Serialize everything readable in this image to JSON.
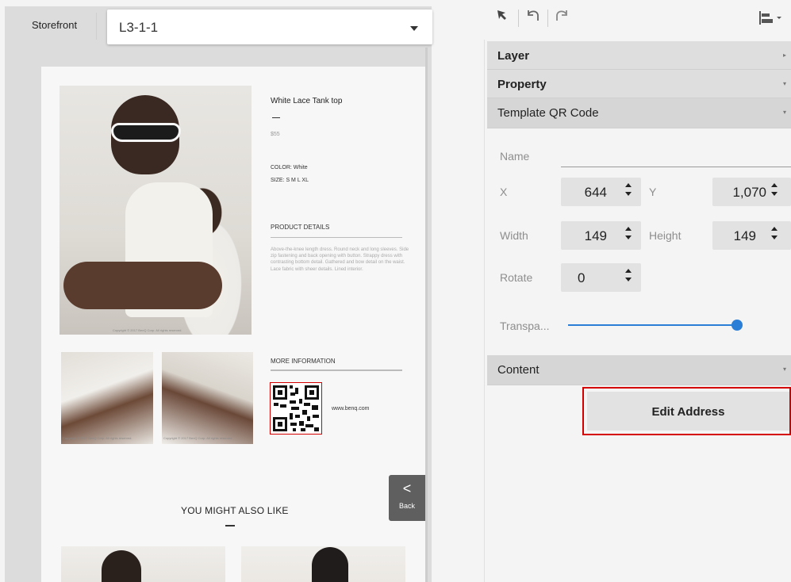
{
  "header": {
    "storefront_label": "Storefront",
    "template_select_value": "L3-1-1"
  },
  "product": {
    "title": "White Lace Tank top",
    "price": "$55",
    "color": "COLOR: White",
    "size": "SIZE: S M L XL",
    "details_heading": "PRODUCT DETAILS",
    "details_text": "Above-the-knee length dress. Round neck and long sleeves. Side zip fastening and back opening with button. Strappy dress with contrasting bottom detail. Gathered and bow detail on the waist. Lace fabric with sheer details. Lined interior.",
    "more_info_heading": "MORE INFORMATION",
    "qr_url": "www.benq.com",
    "photo_caption": "Copyright © 2017 BenQ Corp. All rights reserved.",
    "also_like": "YOU MIGHT ALSO LIKE"
  },
  "back_button": {
    "chevron": "<",
    "label": "Back"
  },
  "toolbar": {
    "icons": [
      "pointer-icon",
      "undo-icon",
      "redo-icon",
      "align-icon"
    ]
  },
  "sections": {
    "layer": "Layer",
    "property": "Property",
    "template_qr": "Template QR Code",
    "content": "Content"
  },
  "properties": {
    "name_label": "Name",
    "name_value": "",
    "x_label": "X",
    "x_value": "644",
    "y_label": "Y",
    "y_value": "1,070",
    "width_label": "Width",
    "width_value": "149",
    "height_label": "Height",
    "height_value": "149",
    "rotate_label": "Rotate",
    "rotate_value": "0",
    "transparency_label": "Transpa...",
    "transparency_value": 1.0
  },
  "content": {
    "edit_address_label": "Edit Address"
  },
  "colors": {
    "accent": "#2a7ed6",
    "highlight": "#d40000",
    "section_bg": "#dedede"
  }
}
